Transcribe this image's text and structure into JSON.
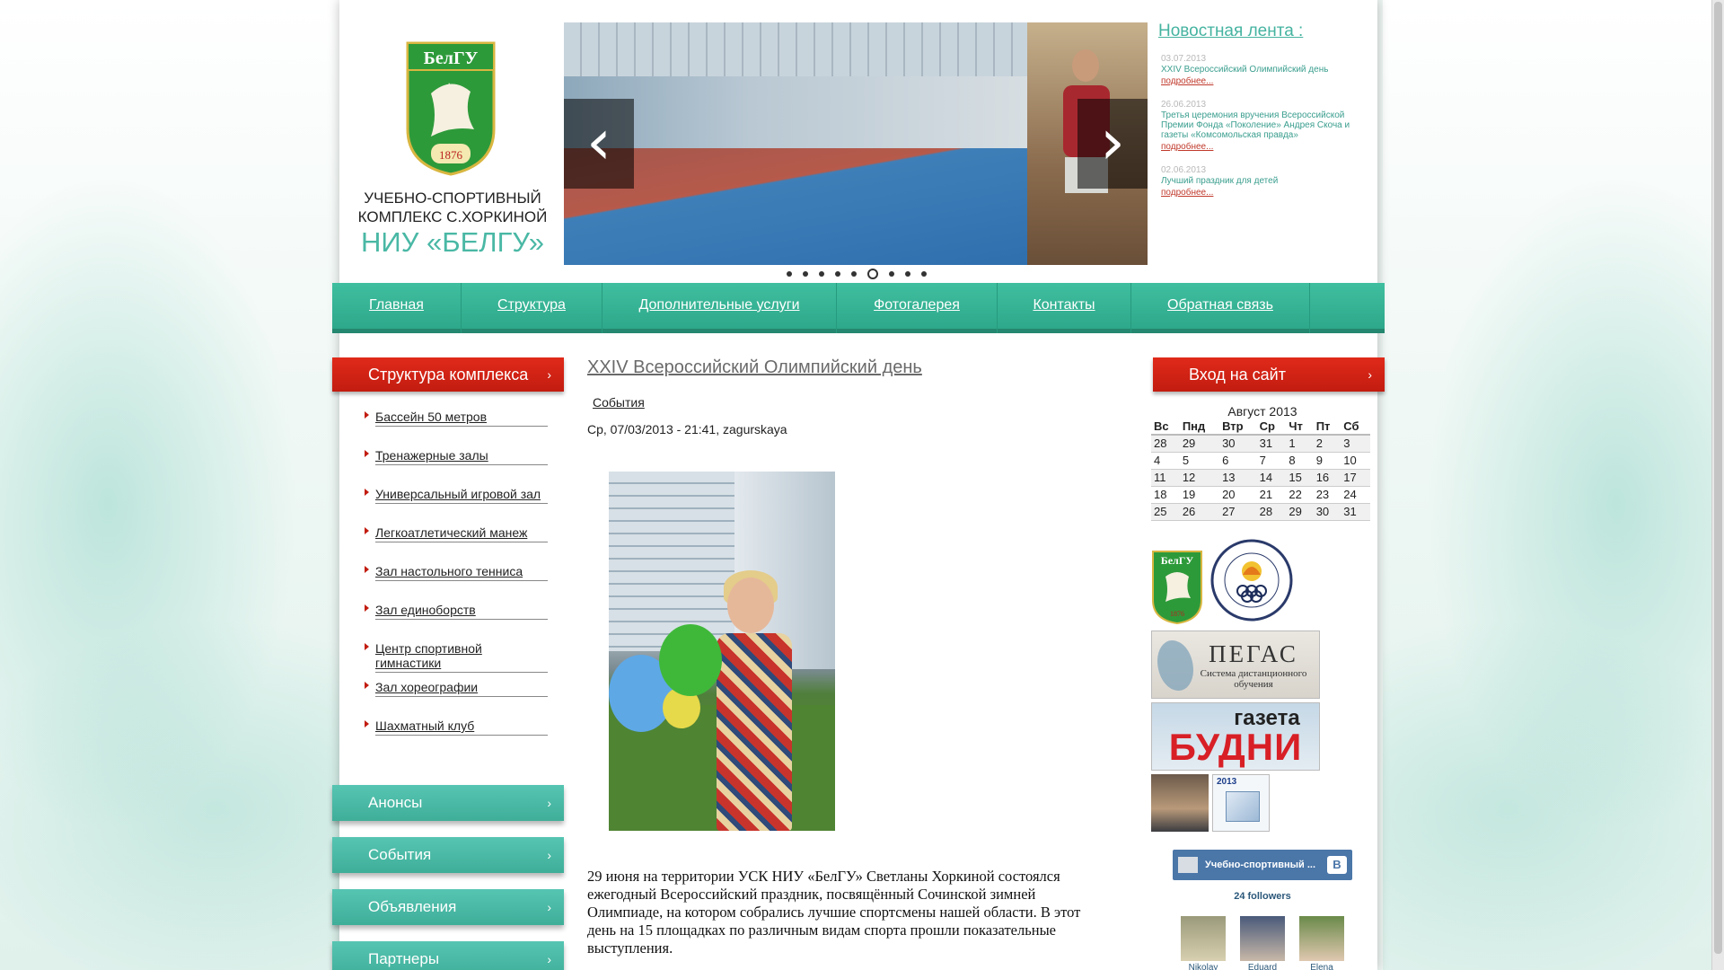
{
  "brand": {
    "shield_text": "БелГУ",
    "shield_year": "1876",
    "line1": "УЧЕБНО-СПОРТИВНЫЙ",
    "line2": "КОМПЛЕКС С.ХОРКИНОЙ",
    "line3": "НИУ «БЕЛГУ»"
  },
  "slider": {
    "prev_icon": "chevron-left-icon",
    "next_icon": "chevron-right-icon",
    "prev_glyph": "‹",
    "next_glyph": "›",
    "dots": 9,
    "active_dot": 6
  },
  "news": {
    "title": "Новостная лента :",
    "items": [
      {
        "date": "03.07.2013",
        "text": "XXIV Всероссийский Олимпийский день",
        "more": "подробнее..."
      },
      {
        "date": "26.06.2013",
        "text": "Третья церемония вручения Всероссийской Премии Фонда «Поколение» Андрея Скоча и газеты «Комсомольская правда»",
        "more": "подробнее..."
      },
      {
        "date": "02.06.2013",
        "text": "Лучший праздник для детей",
        "more": "подробнее..."
      }
    ]
  },
  "nav": {
    "items": [
      "Главная",
      "Структура",
      "Дополнительные услуги",
      "Фотогалерея",
      "Контакты",
      "Обратная связь"
    ]
  },
  "sidebar": {
    "structure_title": "Структура комплекса",
    "structure_items": [
      "Бассейн 50 метров",
      "Тренажерные залы",
      "Универсальный игровой зал",
      "Легкоатлетический манеж",
      "Зал настольного тенниса",
      "Зал единоборств",
      "Центр спортивной гимнастики",
      "Зал хореографии",
      "Шахматный клуб"
    ],
    "accordions": [
      "Анонсы",
      "События",
      "Объявления",
      "Партнеры"
    ],
    "chevron": "›"
  },
  "article": {
    "title": "XXIV Всероссийский Олимпийский день",
    "tag": "События",
    "meta": "Ср, 07/03/2013 - 21:41, zagurskaya",
    "body": "29 июня на территории УСК НИУ «БелГУ» Светланы Хоркиной состоялся ежегодный Всероссийский праздник, посвящённый Сочинской зимней Олимпиаде, на котором собрались лучшие спортсмены нашей области. В этот день на 15 площадках по различным видам спорта прошли показательные выступления."
  },
  "login": {
    "title": "Вход на сайт"
  },
  "calendar": {
    "title": "Август 2013",
    "headers": [
      "Вс",
      "Пнд",
      "Втр",
      "Ср",
      "Чт",
      "Пт",
      "Сб"
    ],
    "rows": [
      [
        "28",
        "29",
        "30",
        "31",
        "1",
        "2",
        "3"
      ],
      [
        "4",
        "5",
        "6",
        "7",
        "8",
        "9",
        "10"
      ],
      [
        "11",
        "12",
        "13",
        "14",
        "15",
        "16",
        "17"
      ],
      [
        "18",
        "19",
        "20",
        "21",
        "22",
        "23",
        "24"
      ],
      [
        "25",
        "26",
        "27",
        "28",
        "29",
        "30",
        "31"
      ]
    ]
  },
  "banners": {
    "pegas_title": "ПЕГАС",
    "pegas_sub": "Система дистанционного обучения",
    "budni_top": "газета",
    "budni_main": "БУДНИ",
    "year_badge": "2013"
  },
  "vk": {
    "group": "Учебно-спортивный ...",
    "logo": "В",
    "followers": "24 followers",
    "members": [
      "Nikolay",
      "Eduard",
      "Elena"
    ]
  },
  "colors": {
    "accent_green": "#3fbf9f",
    "accent_red": "#d8251a",
    "brand_teal": "#4ab8a5"
  }
}
